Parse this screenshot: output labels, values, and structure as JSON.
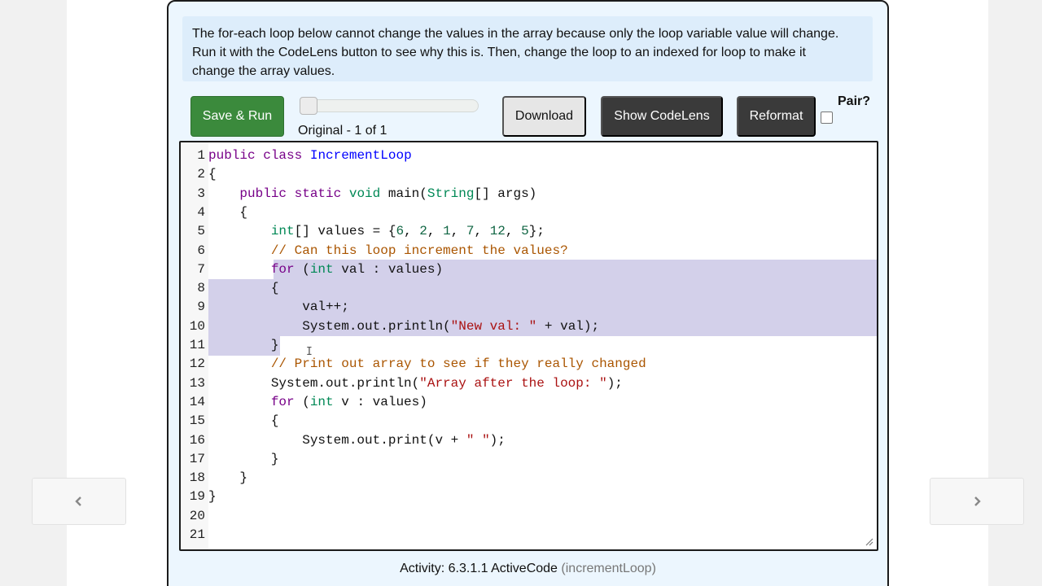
{
  "description": {
    "lines": [
      "The for-each loop below cannot change the values in the array because only the loop variable value will change.",
      "Run it with the CodeLens button to see why this is. Then, change the loop to an indexed for loop to make it",
      "change the array values."
    ]
  },
  "toolbar": {
    "save_run": "Save & Run",
    "history_label": "Original - 1 of 1",
    "download": "Download",
    "show_codelens": "Show CodeLens",
    "reformat": "Reformat",
    "pair_label": "Pair?",
    "pair_checked": false
  },
  "editor": {
    "line_numbers": [
      "1",
      "2",
      "3",
      "4",
      "5",
      "6",
      "7",
      "8",
      "9",
      "10",
      "11",
      "12",
      "13",
      "14",
      "15",
      "16",
      "17",
      "18",
      "19",
      "20",
      "21"
    ],
    "selected_lines": "7-11",
    "code": [
      [
        [
          "kw",
          "public"
        ],
        [
          "plain",
          " "
        ],
        [
          "kw",
          "class"
        ],
        [
          "plain",
          " "
        ],
        [
          "cls",
          "IncrementLoop"
        ]
      ],
      [
        [
          "plain",
          "{"
        ]
      ],
      [
        [
          "plain",
          "    "
        ],
        [
          "kw",
          "public"
        ],
        [
          "plain",
          " "
        ],
        [
          "kw",
          "static"
        ],
        [
          "plain",
          " "
        ],
        [
          "ty",
          "void"
        ],
        [
          "plain",
          " main("
        ],
        [
          "ty",
          "String"
        ],
        [
          "plain",
          "[] args)"
        ]
      ],
      [
        [
          "plain",
          "    {"
        ]
      ],
      [
        [
          "plain",
          "        "
        ],
        [
          "ty",
          "int"
        ],
        [
          "plain",
          "[] values = {"
        ],
        [
          "num",
          "6"
        ],
        [
          "plain",
          ", "
        ],
        [
          "num",
          "2"
        ],
        [
          "plain",
          ", "
        ],
        [
          "num",
          "1"
        ],
        [
          "plain",
          ", "
        ],
        [
          "num",
          "7"
        ],
        [
          "plain",
          ", "
        ],
        [
          "num",
          "12"
        ],
        [
          "plain",
          ", "
        ],
        [
          "num",
          "5"
        ],
        [
          "plain",
          "};"
        ]
      ],
      [
        [
          "plain",
          "        "
        ],
        [
          "cm",
          "// Can this loop increment the values?"
        ]
      ],
      [
        [
          "plain",
          "        "
        ],
        [
          "kw",
          "for"
        ],
        [
          "plain",
          " ("
        ],
        [
          "ty",
          "int"
        ],
        [
          "plain",
          " val : values)"
        ]
      ],
      [
        [
          "plain",
          "        {"
        ]
      ],
      [
        [
          "plain",
          "            val++;"
        ]
      ],
      [
        [
          "plain",
          "            System.out.println("
        ],
        [
          "str",
          "\"New val: \""
        ],
        [
          "plain",
          " + val);"
        ]
      ],
      [
        [
          "plain",
          "        }"
        ]
      ],
      [
        [
          "plain",
          "        "
        ],
        [
          "cm",
          "// Print out array to see if they really changed"
        ]
      ],
      [
        [
          "plain",
          "        System.out.println("
        ],
        [
          "str",
          "\"Array after the loop: \""
        ],
        [
          "plain",
          ");"
        ]
      ],
      [
        [
          "plain",
          "        "
        ],
        [
          "kw",
          "for"
        ],
        [
          "plain",
          " ("
        ],
        [
          "ty",
          "int"
        ],
        [
          "plain",
          " v : values)"
        ]
      ],
      [
        [
          "plain",
          "        {"
        ]
      ],
      [
        [
          "plain",
          "            System.out.print(v + "
        ],
        [
          "str",
          "\" \""
        ],
        [
          "plain",
          ");"
        ]
      ],
      [
        [
          "plain",
          "        }"
        ]
      ],
      [
        [
          "plain",
          "    }"
        ]
      ],
      [
        [
          "plain",
          "}"
        ]
      ],
      [],
      []
    ]
  },
  "footer": {
    "activity_label": "Activity: 6.3.1.1 ActiveCode",
    "activity_id": "(incrementLoop)"
  },
  "colors": {
    "save_button": "#3b8a3c",
    "dark_button": "#3a3a3a",
    "selection": "#d3d0ea",
    "panel_bg": "#ecf6fe",
    "desc_bg": "#ddedfb"
  },
  "icons": {
    "prev": "chevron-left-icon",
    "next": "chevron-right-icon"
  }
}
